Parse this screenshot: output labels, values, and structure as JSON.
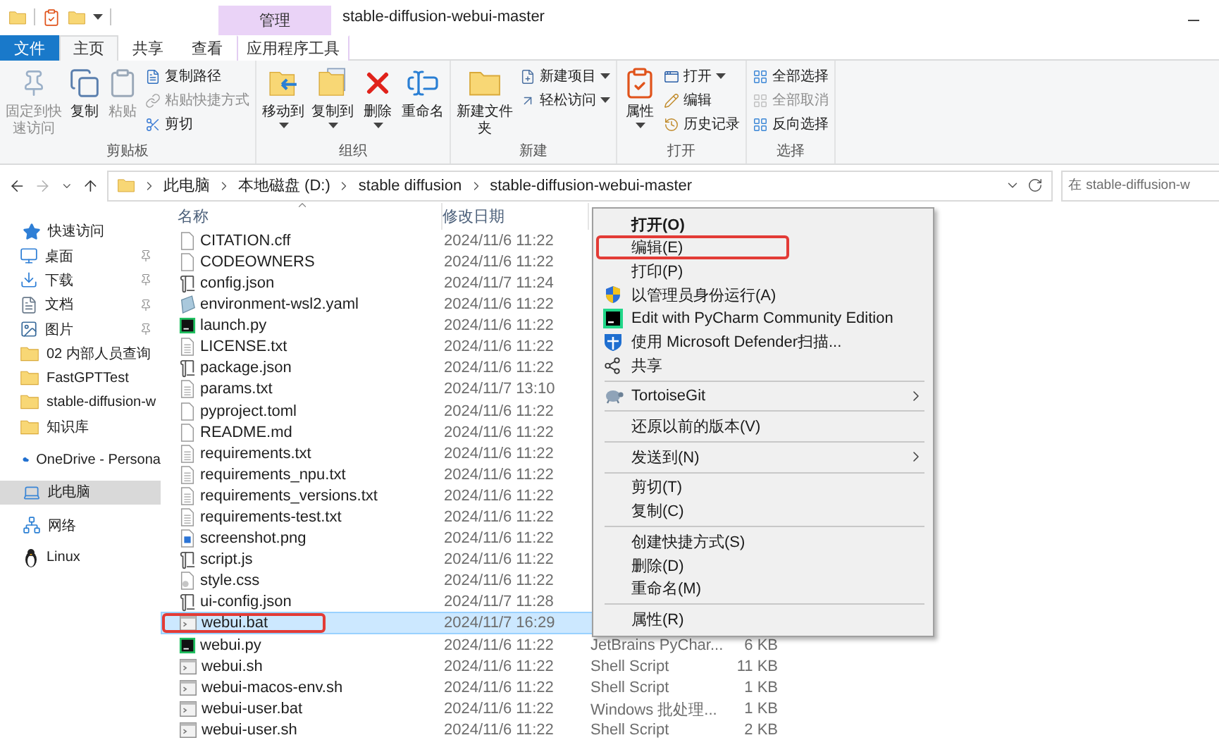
{
  "title_bar": {
    "contextual_header": "管理",
    "title": "stable-diffusion-webui-master"
  },
  "tabs": [
    {
      "label": "文件",
      "kind": "file",
      "selected": false
    },
    {
      "label": "主页",
      "kind": "normal",
      "selected": true
    },
    {
      "label": "共享",
      "kind": "normal",
      "selected": false
    },
    {
      "label": "查看",
      "kind": "normal",
      "selected": false
    },
    {
      "label": "应用程序工具",
      "kind": "contextual",
      "selected": false
    }
  ],
  "ribbon": {
    "groups": [
      {
        "label": "剪贴板",
        "buttons": [
          {
            "label": "固定到快速访问",
            "kind": "large",
            "disabled": true,
            "dropdown": false
          },
          {
            "label": "复制",
            "kind": "large",
            "disabled": false,
            "dropdown": false
          },
          {
            "label": "粘贴",
            "kind": "large",
            "disabled": true,
            "dropdown": false
          },
          {
            "label": "复制路径",
            "kind": "small",
            "disabled": false,
            "dropdown": false
          },
          {
            "label": "粘贴快捷方式",
            "kind": "small",
            "disabled": true,
            "dropdown": false
          },
          {
            "label": "剪切",
            "kind": "small",
            "disabled": false,
            "dropdown": false
          }
        ]
      },
      {
        "label": "组织",
        "buttons": [
          {
            "label": "移动到",
            "kind": "large",
            "disabled": false,
            "dropdown": true
          },
          {
            "label": "复制到",
            "kind": "large",
            "disabled": false,
            "dropdown": true
          },
          {
            "label": "删除",
            "kind": "large",
            "disabled": false,
            "dropdown": true
          },
          {
            "label": "重命名",
            "kind": "large",
            "disabled": false,
            "dropdown": false
          }
        ]
      },
      {
        "label": "新建",
        "buttons": [
          {
            "label": "新建文件夹",
            "kind": "large",
            "disabled": false,
            "dropdown": false
          },
          {
            "label": "新建项目",
            "kind": "small",
            "disabled": false,
            "dropdown": true
          },
          {
            "label": "轻松访问",
            "kind": "small",
            "disabled": false,
            "dropdown": true
          }
        ]
      },
      {
        "label": "打开",
        "buttons": [
          {
            "label": "属性",
            "kind": "large",
            "disabled": false,
            "dropdown": true
          },
          {
            "label": "打开",
            "kind": "small",
            "disabled": false,
            "dropdown": true
          },
          {
            "label": "编辑",
            "kind": "small",
            "disabled": false,
            "dropdown": false
          },
          {
            "label": "历史记录",
            "kind": "small",
            "disabled": false,
            "dropdown": false
          }
        ]
      },
      {
        "label": "选择",
        "buttons": [
          {
            "label": "全部选择",
            "kind": "small",
            "disabled": false,
            "dropdown": false
          },
          {
            "label": "全部取消",
            "kind": "small",
            "disabled": true,
            "dropdown": false
          },
          {
            "label": "反向选择",
            "kind": "small",
            "disabled": false,
            "dropdown": false
          }
        ]
      }
    ]
  },
  "address_bar": {
    "breadcrumbs": [
      "此电脑",
      "本地磁盘 (D:)",
      "stable diffusion",
      "stable-diffusion-webui-master"
    ],
    "search": {
      "placeholder": "在 stable-diffusion-w"
    }
  },
  "sidebar": {
    "items": [
      {
        "label": "快速访问",
        "selected": false,
        "children": [
          {
            "label": "桌面",
            "pinned": true,
            "selected": false
          },
          {
            "label": "下载",
            "pinned": true,
            "selected": false
          },
          {
            "label": "文档",
            "pinned": true,
            "selected": false
          },
          {
            "label": "图片",
            "pinned": true,
            "selected": false
          },
          {
            "label": "02 内部人员查询",
            "pinned": false,
            "selected": false
          },
          {
            "label": "FastGPTTest",
            "pinned": false,
            "selected": false
          },
          {
            "label": "stable-diffusion-w",
            "pinned": false,
            "selected": false
          },
          {
            "label": "知识库",
            "pinned": false,
            "selected": false
          }
        ]
      },
      {
        "label": "OneDrive - Persona",
        "selected": false
      },
      {
        "label": "此电脑",
        "selected": true
      },
      {
        "label": "网络",
        "selected": false
      },
      {
        "label": "Linux",
        "selected": false
      }
    ]
  },
  "file_list": {
    "columns": [
      "名称",
      "修改日期"
    ],
    "rows": [
      {
        "name": "CITATION.cff",
        "date": "2024/11/6 11:22",
        "selected": false,
        "highlighted": false
      },
      {
        "name": "CODEOWNERS",
        "date": "2024/11/6 11:22",
        "selected": false,
        "highlighted": false
      },
      {
        "name": "config.json",
        "date": "2024/11/7 11:24",
        "selected": false,
        "highlighted": false
      },
      {
        "name": "environment-wsl2.yaml",
        "date": "2024/11/6 11:22",
        "selected": false,
        "highlighted": false
      },
      {
        "name": "launch.py",
        "date": "2024/11/6 11:22",
        "selected": false,
        "highlighted": false
      },
      {
        "name": "LICENSE.txt",
        "date": "2024/11/6 11:22",
        "selected": false,
        "highlighted": false
      },
      {
        "name": "package.json",
        "date": "2024/11/6 11:22",
        "selected": false,
        "highlighted": false
      },
      {
        "name": "params.txt",
        "date": "2024/11/7 13:10",
        "selected": false,
        "highlighted": false
      },
      {
        "name": "pyproject.toml",
        "date": "2024/11/6 11:22",
        "selected": false,
        "highlighted": false
      },
      {
        "name": "README.md",
        "date": "2024/11/6 11:22",
        "selected": false,
        "highlighted": false
      },
      {
        "name": "requirements.txt",
        "date": "2024/11/6 11:22",
        "selected": false,
        "highlighted": false
      },
      {
        "name": "requirements_npu.txt",
        "date": "2024/11/6 11:22",
        "selected": false,
        "highlighted": false
      },
      {
        "name": "requirements_versions.txt",
        "date": "2024/11/6 11:22",
        "selected": false,
        "highlighted": false
      },
      {
        "name": "requirements-test.txt",
        "date": "2024/11/6 11:22",
        "selected": false,
        "highlighted": false
      },
      {
        "name": "screenshot.png",
        "date": "2024/11/6 11:22",
        "selected": false,
        "highlighted": false
      },
      {
        "name": "script.js",
        "date": "2024/11/6 11:22",
        "selected": false,
        "highlighted": false
      },
      {
        "name": "style.css",
        "date": "2024/11/6 11:22",
        "selected": false,
        "highlighted": false
      },
      {
        "name": "ui-config.json",
        "date": "2024/11/7 11:28",
        "selected": false,
        "highlighted": false
      },
      {
        "name": "webui.bat",
        "date": "2024/11/7 16:29",
        "selected": true,
        "highlighted": true
      },
      {
        "name": "webui.py",
        "date": "2024/11/6 11:22",
        "type": "JetBrains PyChar...",
        "size": "6 KB",
        "selected": false,
        "highlighted": false
      },
      {
        "name": "webui.sh",
        "date": "2024/11/6 11:22",
        "type": "Shell Script",
        "size": "11 KB",
        "selected": false,
        "highlighted": false
      },
      {
        "name": "webui-macos-env.sh",
        "date": "2024/11/6 11:22",
        "type": "Shell Script",
        "size": "1 KB",
        "selected": false,
        "highlighted": false
      },
      {
        "name": "webui-user.bat",
        "date": "2024/11/6 11:22",
        "type": "Windows 批处理...",
        "size": "1 KB",
        "selected": false,
        "highlighted": false
      },
      {
        "name": "webui-user.sh",
        "date": "2024/11/6 11:22",
        "type": "Shell Script",
        "size": "2 KB",
        "selected": false,
        "highlighted": false
      }
    ]
  },
  "context_menu": {
    "items": [
      {
        "kind": "item",
        "label": "打开(O)",
        "default": true,
        "submenu": false,
        "highlighted": false
      },
      {
        "kind": "item",
        "label": "编辑(E)",
        "default": false,
        "submenu": false,
        "highlighted": true
      },
      {
        "kind": "item",
        "label": "打印(P)",
        "default": false,
        "submenu": false,
        "highlighted": false
      },
      {
        "kind": "item",
        "label": "以管理员身份运行(A)",
        "default": false,
        "submenu": false,
        "highlighted": false
      },
      {
        "kind": "item",
        "label": "Edit with PyCharm Community Edition",
        "default": false,
        "submenu": false,
        "highlighted": false
      },
      {
        "kind": "item",
        "label": "使用 Microsoft Defender扫描...",
        "default": false,
        "submenu": false,
        "highlighted": false
      },
      {
        "kind": "item",
        "label": "共享",
        "default": false,
        "submenu": false,
        "highlighted": false
      },
      {
        "kind": "separator"
      },
      {
        "kind": "item",
        "label": "TortoiseGit",
        "default": false,
        "submenu": true,
        "highlighted": false
      },
      {
        "kind": "separator"
      },
      {
        "kind": "item",
        "label": "还原以前的版本(V)",
        "default": false,
        "submenu": false,
        "highlighted": false
      },
      {
        "kind": "separator"
      },
      {
        "kind": "item",
        "label": "发送到(N)",
        "default": false,
        "submenu": true,
        "highlighted": false
      },
      {
        "kind": "separator"
      },
      {
        "kind": "item",
        "label": "剪切(T)",
        "default": false,
        "submenu": false,
        "highlighted": false
      },
      {
        "kind": "item",
        "label": "复制(C)",
        "default": false,
        "submenu": false,
        "highlighted": false
      },
      {
        "kind": "separator"
      },
      {
        "kind": "item",
        "label": "创建快捷方式(S)",
        "default": false,
        "submenu": false,
        "highlighted": false
      },
      {
        "kind": "item",
        "label": "删除(D)",
        "default": false,
        "submenu": false,
        "highlighted": false
      },
      {
        "kind": "item",
        "label": "重命名(M)",
        "default": false,
        "submenu": false,
        "highlighted": false
      },
      {
        "kind": "separator"
      },
      {
        "kind": "item",
        "label": "属性(R)",
        "default": false,
        "submenu": false,
        "highlighted": false
      }
    ]
  }
}
